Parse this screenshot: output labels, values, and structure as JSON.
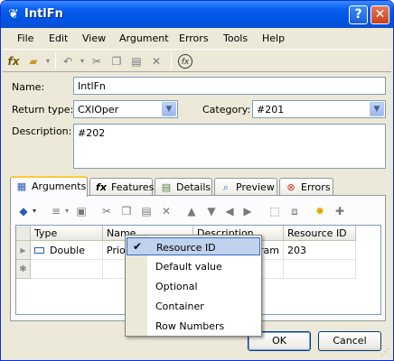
{
  "window": {
    "title": "IntlFn"
  },
  "menu": [
    "File",
    "Edit",
    "View",
    "Argument",
    "Errors",
    "Tools",
    "Help"
  ],
  "form": {
    "name_label": "Name:",
    "name_value": "IntlFn",
    "return_type_label": "Return type:",
    "return_type_value": "CXlOper",
    "category_label": "Category:",
    "category_value": "#201",
    "description_label": "Description:",
    "description_value": "#202"
  },
  "tabs": [
    {
      "label": "Arguments",
      "icon": "arguments-icon",
      "active": true
    },
    {
      "label": "Features",
      "icon": "fx-icon"
    },
    {
      "label": "Details",
      "icon": "details-icon"
    },
    {
      "label": "Preview",
      "icon": "preview-icon"
    },
    {
      "label": "Errors",
      "icon": "errors-icon"
    }
  ],
  "grid": {
    "columns": [
      "Type",
      "Name",
      "Description",
      "Resource ID"
    ],
    "rows": [
      {
        "type": "Double",
        "name": "Prio",
        "description": "ram",
        "resource_id": "203"
      }
    ]
  },
  "context_menu": {
    "items": [
      {
        "label": "Resource ID",
        "checked": true,
        "highlighted": true
      },
      {
        "label": "Default value"
      },
      {
        "label": "Optional"
      },
      {
        "label": "Container"
      },
      {
        "label": "Row Numbers"
      }
    ]
  },
  "buttons": {
    "ok": "OK",
    "cancel": "Cancel"
  },
  "colors": {
    "titlebar": "#0054e3",
    "selection": "#c1d2ee",
    "window": "#ece9d8"
  }
}
